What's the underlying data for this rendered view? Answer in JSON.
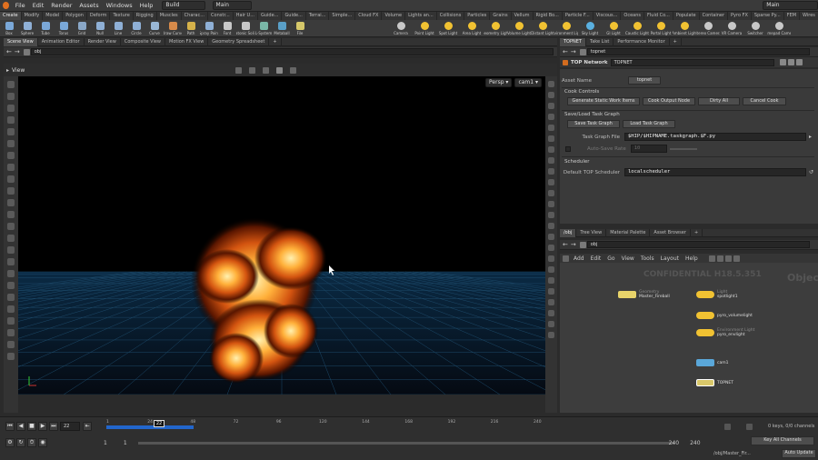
{
  "menubar": {
    "items": [
      "File",
      "Edit",
      "Render",
      "Assets",
      "Windows",
      "Help"
    ],
    "desktop": "Build",
    "context": "Main",
    "right_context": "Main"
  },
  "shelf_tabs": [
    "Create",
    "Modify",
    "Model",
    "Polygon",
    "Deform",
    "Texture",
    "Rigging",
    "Muscles",
    "Charac...",
    "Constr...",
    "Hair U...",
    "Guide...",
    "Guide...",
    "Terrai...",
    "Simple...",
    "Cloud FX",
    "Volume",
    "Lights an...",
    "Collisions",
    "Particles",
    "Grains",
    "Vellum",
    "Rigid Bo...",
    "Particle F...",
    "Viscous...",
    "Oceans",
    "Fluid Co...",
    "Populate",
    "Container",
    "Pyro FX",
    "Sparse Py...",
    "FEM",
    "Wires",
    "Crowds",
    "Drive Si..."
  ],
  "shelf_tools_left": [
    "Box",
    "Sphere",
    "Tube",
    "Torus",
    "Grid",
    "Null",
    "Line",
    "Circle",
    "Curve",
    "Draw Curve",
    "Path",
    "Spray Paint",
    "Font",
    "Platonic Solids",
    "L-System",
    "Metaball",
    "File"
  ],
  "shelf_tools_right": [
    "Camera",
    "Point Light",
    "Spot Light",
    "Area Light",
    "Geometry Light",
    "Volume Light",
    "Distant Light",
    "Environment Light",
    "Sky Light",
    "GI Light",
    "Caustic Light",
    "Portal Light",
    "Ambient Light",
    "Stereo Camera",
    "VR Camera",
    "Switcher",
    "Gamepad Camera"
  ],
  "left_pane": {
    "tabs": [
      "Scene View",
      "Animation Editor",
      "Render View",
      "Composite View",
      "Motion FX View",
      "Geometry Spreadsheet"
    ],
    "path": "obj",
    "view_label": "View",
    "persp": "Persp",
    "camera": "cam1"
  },
  "params_pane": {
    "tabs": [
      "TOPNET",
      "Take List",
      "Performance Monitor"
    ],
    "path": "topnet",
    "node_type": "TOP Network",
    "node_name": "TOPNET",
    "asset_name_label": "Asset Name",
    "asset_name_value": "topnet",
    "cook_controls": "Cook Controls",
    "buttons": [
      "Generate Static Work Items",
      "Cook Output Node",
      "Dirty All",
      "Cancel Cook"
    ],
    "save_load_section": "Save/Load Task Graph",
    "save_btn": "Save Task Graph",
    "load_btn": "Load Task Graph",
    "task_graph_file_label": "Task Graph File",
    "task_graph_file_value": "$HIP/$HIPNAME.taskgraph.$F.py",
    "auto_save_label": "Auto-Save Rate",
    "auto_save_value": "10",
    "scheduler_section": "Scheduler",
    "default_scheduler_label": "Default TOP Scheduler",
    "default_scheduler_value": "localscheduler"
  },
  "network_pane": {
    "tabs": [
      "/obj",
      "Tree View",
      "Material Palette",
      "Asset Browser"
    ],
    "path": "obj",
    "menu": [
      "Add",
      "Edit",
      "Go",
      "View",
      "Tools",
      "Layout",
      "Help"
    ],
    "watermark": "CONFIDENTIAL  H18.5.351",
    "corner_label": "Objec",
    "nodes": [
      {
        "sub": "Geometry",
        "name": "Master_Fireball",
        "color": "#e8d36a"
      },
      {
        "sub": "Light",
        "name": "spotlight1",
        "color": "#f1c232"
      },
      {
        "sub": "",
        "name": "pyro_volumelight",
        "color": "#f1c232"
      },
      {
        "sub": "Environment Light",
        "name": "pyro_envlight",
        "color": "#f1c232"
      },
      {
        "sub": "",
        "name": "cam1",
        "color": "#5aa7d9"
      },
      {
        "sub": "",
        "name": "TOPNET",
        "color": "#d9c86a"
      }
    ]
  },
  "timeline": {
    "current_frame": "22",
    "ticks": [
      "1",
      "24",
      "48",
      "72",
      "96",
      "120",
      "144",
      "168",
      "192",
      "216",
      "240"
    ],
    "start": "1",
    "start2": "1",
    "end": "240",
    "end2": "240",
    "keys_info": "0 keys, 0/0 channels",
    "key_all": "Key All Channels",
    "status_path": "/obj/Master_Fir...",
    "auto_update": "Auto Update"
  }
}
